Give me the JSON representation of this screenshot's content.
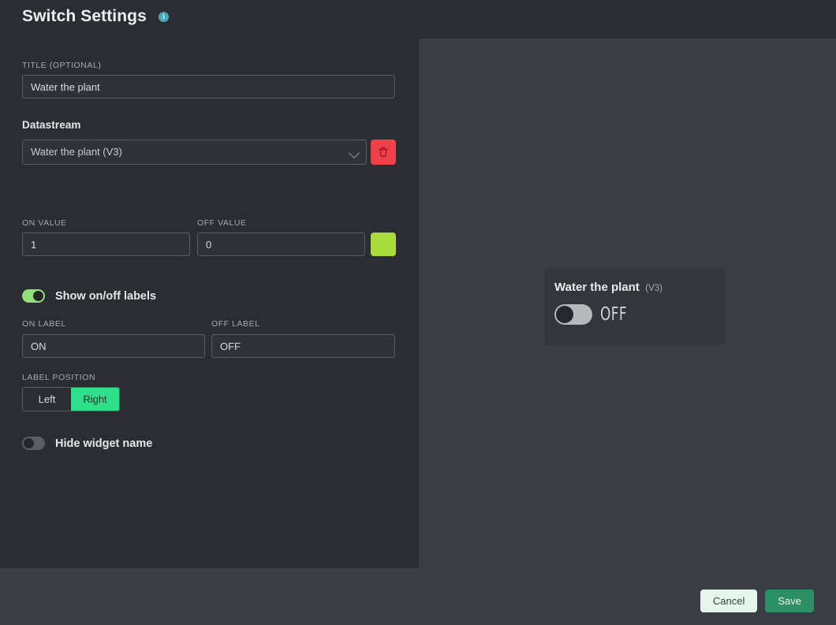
{
  "header": {
    "title": "Switch Settings",
    "info_icon": "info-icon",
    "info_glyph": "i"
  },
  "form": {
    "title_field": {
      "label": "TITLE (OPTIONAL)",
      "value": "Water the plant",
      "placeholder": "Title"
    },
    "datastream": {
      "heading": "Datastream",
      "selected": "Water the plant (V3)",
      "chevron_icon": "chevron-down-icon",
      "delete_icon": "trash-icon",
      "delete_color": "#f0404a"
    },
    "on_value": {
      "label": "ON VALUE",
      "value": "1",
      "placeholder": "ON value"
    },
    "off_value": {
      "label": "OFF VALUE",
      "value": "0",
      "placeholder": "OFF value"
    },
    "color_swatch": {
      "name": "color-swatch",
      "color": "#a8db3c"
    },
    "show_labels_toggle": {
      "label": "Show on/off labels",
      "state": "on",
      "on_color": "#8fe07a"
    },
    "on_label": {
      "label": "ON LABEL",
      "value": "ON",
      "placeholder": "ON"
    },
    "off_label": {
      "label": "OFF LABEL",
      "value": "OFF",
      "placeholder": "OFF"
    },
    "label_position": {
      "label": "LABEL POSITION",
      "options": [
        "Left",
        "Right"
      ],
      "selected": "Right",
      "active_color": "#2ee08a"
    },
    "hide_widget_toggle": {
      "label": "Hide widget name",
      "state": "off"
    }
  },
  "preview": {
    "widget_name": "Water the plant",
    "widget_pin": "(V3)",
    "toggle_state": "off",
    "state_text": "OFF"
  },
  "footer": {
    "cancel_label": "Cancel",
    "save_label": "Save",
    "save_color": "#2d8f66"
  }
}
